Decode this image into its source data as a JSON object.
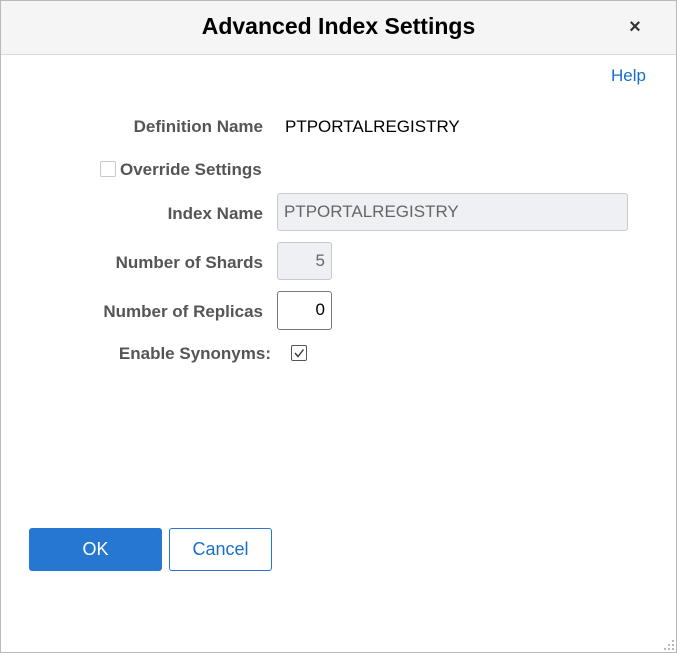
{
  "dialog": {
    "title": "Advanced Index Settings",
    "close_label": "×",
    "help_label": "Help"
  },
  "form": {
    "definition_name": {
      "label": "Definition Name",
      "value": "PTPORTALREGISTRY"
    },
    "override_settings": {
      "label": "Override Settings",
      "checked": false
    },
    "index_name": {
      "label": "Index Name",
      "value": "PTPORTALREGISTRY",
      "disabled": true
    },
    "number_of_shards": {
      "label": "Number of Shards",
      "value": "5",
      "disabled": true
    },
    "number_of_replicas": {
      "label": "Number of Replicas",
      "value": "0",
      "disabled": false
    },
    "enable_synonyms": {
      "label": "Enable Synonyms:",
      "checked": true
    }
  },
  "buttons": {
    "ok_label": "OK",
    "cancel_label": "Cancel"
  },
  "icons": {
    "close": "close-icon",
    "checkmark": "checkmark-icon",
    "resize": "resize-grip-icon"
  },
  "colors": {
    "accent": "#2677cf",
    "link": "#1a6ec9",
    "label": "#555555",
    "disabled_bg": "#eef0f3"
  }
}
